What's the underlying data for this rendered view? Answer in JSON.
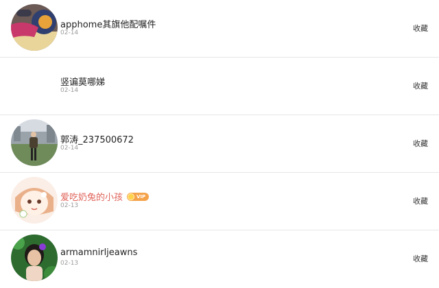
{
  "favorite_list": {
    "items": [
      {
        "name": "apphome其旗他配嘱件",
        "date": "02-14",
        "action": "收藏",
        "vip": false,
        "avatar": "avatar-photo"
      },
      {
        "name": "竖谝莫哪娣",
        "date": "02-14",
        "action": "收藏",
        "vip": false,
        "avatar": "none"
      },
      {
        "name": "郭涛_237500672",
        "date": "02-14",
        "action": "收藏",
        "vip": false,
        "avatar": "avatar-photo"
      },
      {
        "name": "爱吃奶兔的小孩",
        "date": "02-13",
        "action": "收藏",
        "vip": true,
        "vip_label": "VIP",
        "avatar": "avatar-cartoon"
      },
      {
        "name": "armamnirljeawns",
        "date": "02-13",
        "action": "收藏",
        "vip": false,
        "avatar": "avatar-photo"
      }
    ]
  },
  "colors": {
    "divider": "#e6e6e6",
    "name": "#222222",
    "vip_name": "#e0635a",
    "date": "#9a9a9a",
    "vip_badge": "#f5a34b"
  }
}
